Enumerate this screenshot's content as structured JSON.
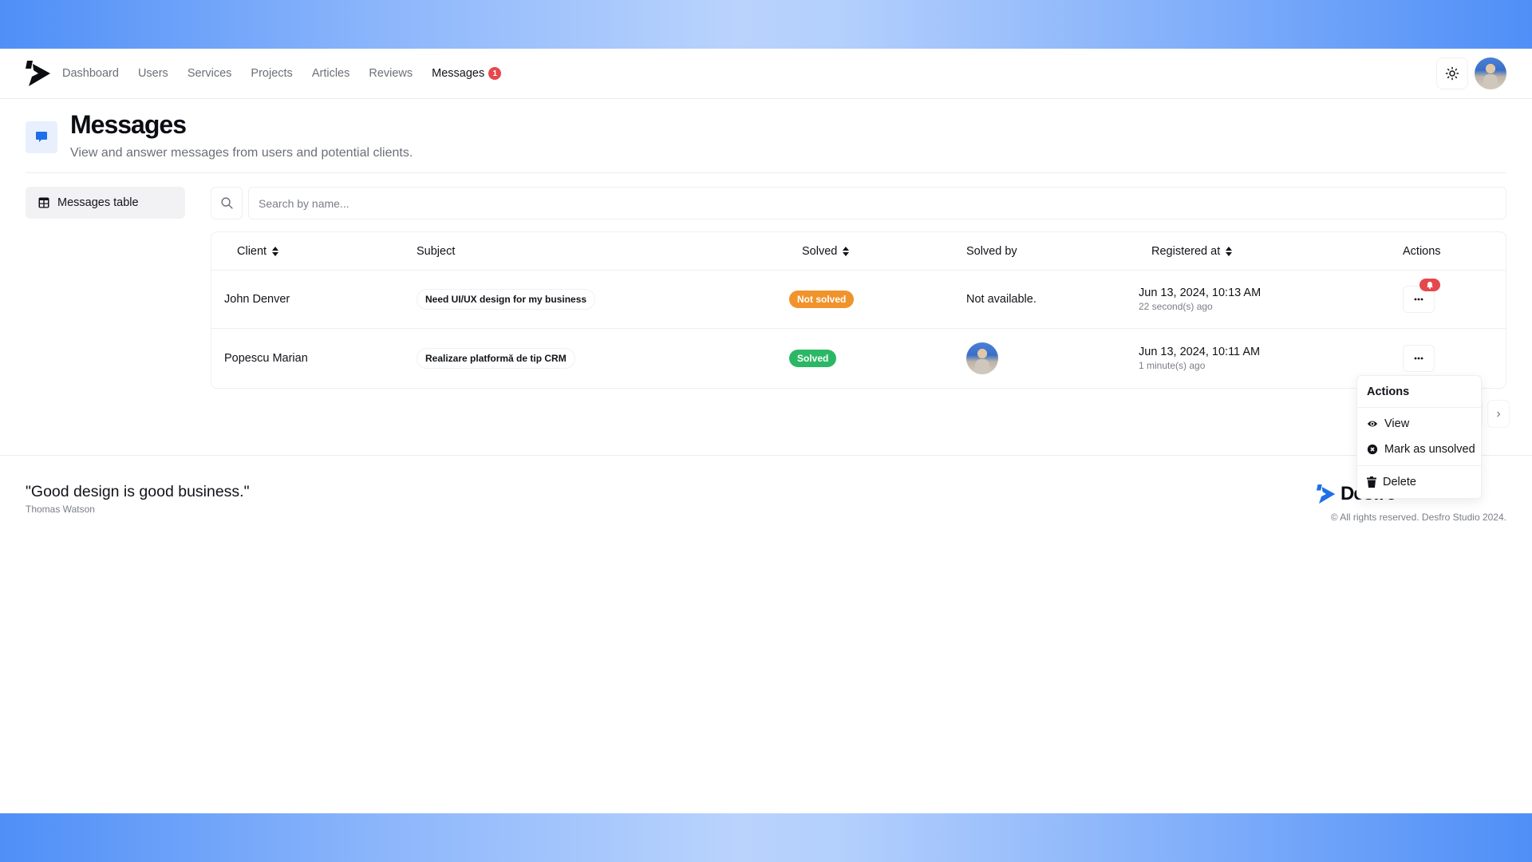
{
  "nav": {
    "items": [
      {
        "label": "Dashboard"
      },
      {
        "label": "Users"
      },
      {
        "label": "Services"
      },
      {
        "label": "Projects"
      },
      {
        "label": "Articles"
      },
      {
        "label": "Reviews"
      },
      {
        "label": "Messages",
        "active": true,
        "badge": "1"
      }
    ],
    "theme_icon": "sun-icon"
  },
  "header": {
    "title": "Messages",
    "subtitle": "View and answer messages from users and potential clients.",
    "icon": "message-icon"
  },
  "sidebar": {
    "items": [
      {
        "label": "Messages table",
        "icon": "table-icon"
      }
    ]
  },
  "search": {
    "placeholder": "Search by name...",
    "value": ""
  },
  "table": {
    "columns": [
      {
        "label": "Client",
        "sortable": true
      },
      {
        "label": "Subject",
        "sortable": false
      },
      {
        "label": "Solved",
        "sortable": true
      },
      {
        "label": "Solved by",
        "sortable": false
      },
      {
        "label": "Registered at",
        "sortable": true
      },
      {
        "label": "Actions",
        "sortable": false
      }
    ],
    "rows": [
      {
        "client": "John Denver",
        "subject": "Need UI/UX design for my business",
        "status": "Not solved",
        "solved_by": "Not available.",
        "registered": "Jun 13, 2024, 10:13 AM",
        "registered_ago": "22 second(s) ago",
        "notification": true
      },
      {
        "client": "Popescu Marian",
        "subject": "Realizare platformă de tip CRM",
        "status": "Solved",
        "solved_by": "avatar",
        "registered": "Jun 13, 2024, 10:11 AM",
        "registered_ago": "1 minute(s) ago",
        "notification": false
      }
    ]
  },
  "pagination": {
    "prev": "‹",
    "next": "›"
  },
  "dropdown": {
    "title": "Actions",
    "items": [
      {
        "label": "View",
        "icon": "eye-icon"
      },
      {
        "label": "Mark as unsolved",
        "icon": "x-circle-icon"
      },
      {
        "label": "Delete",
        "icon": "trash-icon"
      }
    ]
  },
  "footer": {
    "quote": "\"Good design is good business.\"",
    "author": "Thomas Watson",
    "brand": "Desfro",
    "copyright": "© All rights reserved. Desfro Studio 2024."
  },
  "colors": {
    "accent": "#1f6feb",
    "not_solved": "#f0932b",
    "solved": "#2bb866",
    "badge": "#e5484d"
  }
}
